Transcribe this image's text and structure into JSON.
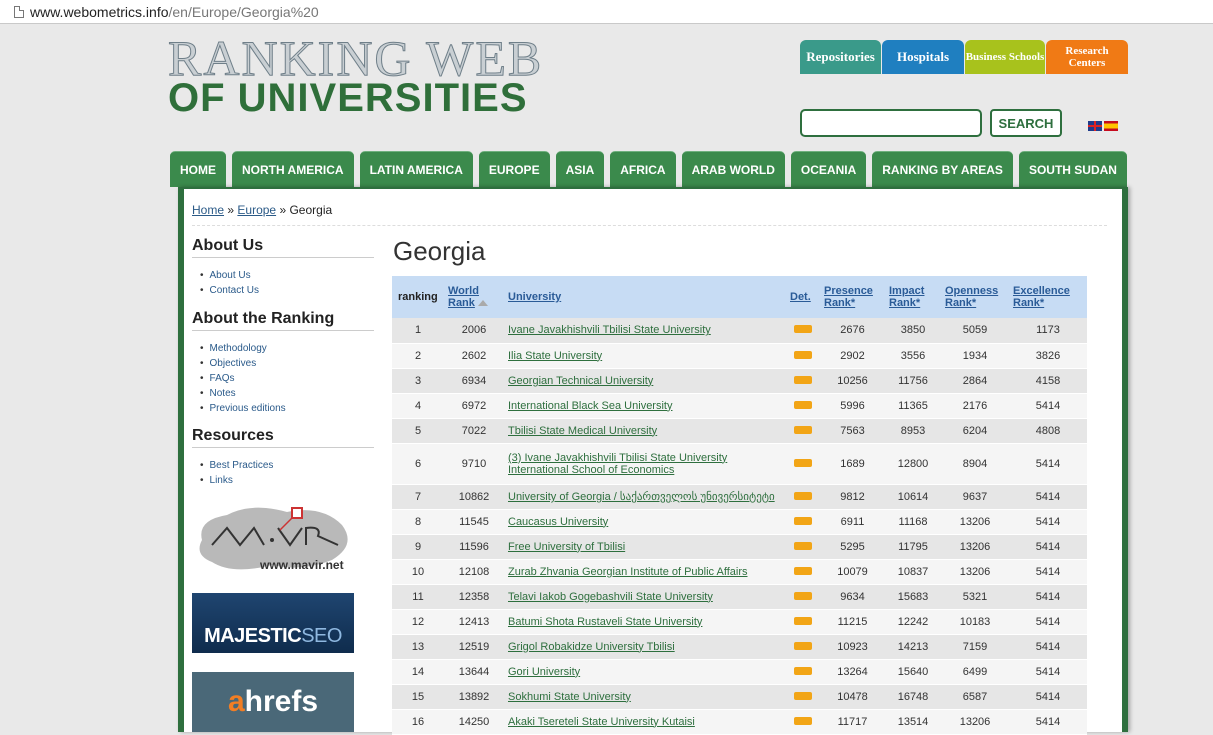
{
  "browser": {
    "url_host": "www.webometrics.info",
    "url_path": "/en/Europe/Georgia%20"
  },
  "logo": {
    "line1": "RANKING WEB",
    "line2": "OF UNIVERSITIES"
  },
  "top_buttons": [
    {
      "label": "Repositories"
    },
    {
      "label": "Hospitals"
    },
    {
      "label": "Business Schools"
    },
    {
      "label": "Research Centers"
    }
  ],
  "search": {
    "button_label": "SEARCH"
  },
  "nav": [
    "HOME",
    "NORTH AMERICA",
    "LATIN AMERICA",
    "EUROPE",
    "ASIA",
    "AFRICA",
    "ARAB WORLD",
    "OCEANIA",
    "RANKING BY AREAS",
    "SOUTH SUDAN"
  ],
  "breadcrumb": {
    "home": "Home",
    "sep": "»",
    "europe": "Europe",
    "current": "Georgia"
  },
  "sidebar": {
    "about_us": {
      "title": "About Us",
      "items": [
        "About Us",
        "Contact Us"
      ]
    },
    "about_ranking": {
      "title": "About the Ranking",
      "items": [
        "Methodology",
        "Objectives",
        "FAQs",
        "Notes",
        "Previous editions"
      ]
    },
    "resources": {
      "title": "Resources",
      "items": [
        "Best Practices",
        "Links"
      ]
    },
    "ads": {
      "mavir": "www.mavir.net",
      "majestic_a": "MAJESTIC",
      "majestic_b": "SEO",
      "ahrefs_a": "a",
      "ahrefs_b": "hrefs"
    }
  },
  "page_title": "Georgia",
  "table": {
    "headers": {
      "ranking": "ranking",
      "world_rank_1": "World",
      "world_rank_2": "Rank",
      "university": "University",
      "det": "Det.",
      "presence_1": "Presence",
      "presence_2": "Rank*",
      "impact_1": "Impact",
      "impact_2": "Rank*",
      "openness_1": "Openness",
      "openness_2": "Rank*",
      "excellence_1": "Excellence",
      "excellence_2": "Rank*"
    },
    "rows": [
      {
        "rank": "1",
        "world": "2006",
        "university": "Ivane Javakhishvili Tbilisi State University",
        "presence": "2676",
        "impact": "3850",
        "openness": "5059",
        "excellence": "1173"
      },
      {
        "rank": "2",
        "world": "2602",
        "university": "Ilia State University",
        "presence": "2902",
        "impact": "3556",
        "openness": "1934",
        "excellence": "3826"
      },
      {
        "rank": "3",
        "world": "6934",
        "university": "Georgian Technical University",
        "presence": "10256",
        "impact": "11756",
        "openness": "2864",
        "excellence": "4158"
      },
      {
        "rank": "4",
        "world": "6972",
        "university": "International Black Sea University",
        "presence": "5996",
        "impact": "11365",
        "openness": "2176",
        "excellence": "5414"
      },
      {
        "rank": "5",
        "world": "7022",
        "university": "Tbilisi State Medical University",
        "presence": "7563",
        "impact": "8953",
        "openness": "6204",
        "excellence": "4808"
      },
      {
        "rank": "6",
        "world": "9710",
        "university": "(3) Ivane Javakhishvili Tbilisi State University International School of Economics",
        "presence": "1689",
        "impact": "12800",
        "openness": "8904",
        "excellence": "5414"
      },
      {
        "rank": "7",
        "world": "10862",
        "university": "University of Georgia / საქართველოს უნივერსიტეტი",
        "presence": "9812",
        "impact": "10614",
        "openness": "9637",
        "excellence": "5414"
      },
      {
        "rank": "8",
        "world": "11545",
        "university": "Caucasus University",
        "presence": "6911",
        "impact": "11168",
        "openness": "13206",
        "excellence": "5414"
      },
      {
        "rank": "9",
        "world": "11596",
        "university": "Free University of Tbilisi",
        "presence": "5295",
        "impact": "11795",
        "openness": "13206",
        "excellence": "5414"
      },
      {
        "rank": "10",
        "world": "12108",
        "university": "Zurab Zhvania Georgian Institute of Public Affairs",
        "presence": "10079",
        "impact": "10837",
        "openness": "13206",
        "excellence": "5414"
      },
      {
        "rank": "11",
        "world": "12358",
        "university": "Telavi Iakob Gogebashvili State University",
        "presence": "9634",
        "impact": "15683",
        "openness": "5321",
        "excellence": "5414"
      },
      {
        "rank": "12",
        "world": "12413",
        "university": "Batumi Shota Rustaveli State University",
        "presence": "11215",
        "impact": "12242",
        "openness": "10183",
        "excellence": "5414"
      },
      {
        "rank": "13",
        "world": "12519",
        "university": "Grigol Robakidze University Tbilisi",
        "presence": "10923",
        "impact": "14213",
        "openness": "7159",
        "excellence": "5414"
      },
      {
        "rank": "14",
        "world": "13644",
        "university": "Gori University",
        "presence": "13264",
        "impact": "15640",
        "openness": "6499",
        "excellence": "5414"
      },
      {
        "rank": "15",
        "world": "13892",
        "university": "Sokhumi State University",
        "presence": "10478",
        "impact": "16748",
        "openness": "6587",
        "excellence": "5414"
      },
      {
        "rank": "16",
        "world": "14250",
        "university": "Akaki Tsereteli State University Kutaisi",
        "presence": "11717",
        "impact": "13514",
        "openness": "13206",
        "excellence": "5414"
      }
    ]
  }
}
